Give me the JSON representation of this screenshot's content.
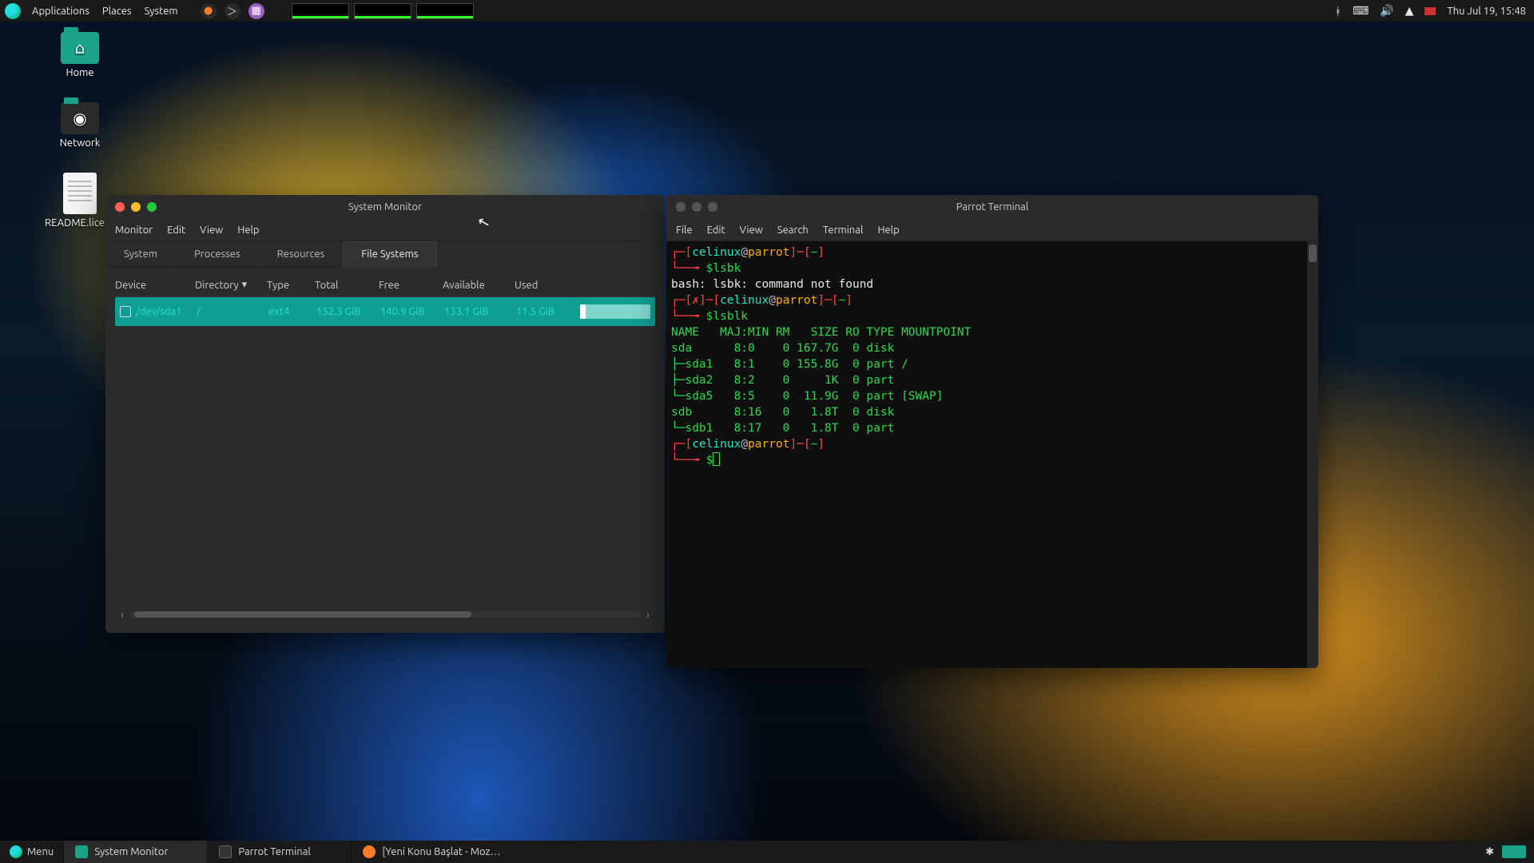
{
  "top_panel": {
    "menus": [
      "Applications",
      "Places",
      "System"
    ],
    "datetime": "Thu Jul 19, 15:48"
  },
  "desktop": {
    "icons": [
      {
        "label": "Home"
      },
      {
        "label": "Network"
      },
      {
        "label": "README.licens"
      }
    ]
  },
  "sysmon": {
    "title": "System Monitor",
    "menus": [
      "Monitor",
      "Edit",
      "View",
      "Help"
    ],
    "tabs": [
      "System",
      "Processes",
      "Resources",
      "File Systems"
    ],
    "active_tab": 3,
    "columns": [
      "Device",
      "Directory",
      "Type",
      "Total",
      "Free",
      "Available",
      "Used"
    ],
    "row": {
      "device": "/dev/sda1",
      "directory": "/",
      "type": "ext4",
      "total": "152.3 GiB",
      "free": "140.9 GiB",
      "available": "133.1 GiB",
      "used": "11.5 GiB",
      "used_pct": 8
    }
  },
  "terminal": {
    "title": "Parrot Terminal",
    "menus": [
      "File",
      "Edit",
      "View",
      "Search",
      "Terminal",
      "Help"
    ],
    "user": "celinux",
    "host": "parrot",
    "cwd": "~",
    "cmd1": "$lsbk",
    "err": "bash: lsbk: command not found",
    "cmd2": "$lsblk",
    "hdr": "NAME   MAJ:MIN RM   SIZE RO TYPE MOUNTPOINT",
    "rows": [
      "sda      8:0    0 167.7G  0 disk",
      "├─sda1   8:1    0 155.8G  0 part /",
      "├─sda2   8:2    0     1K  0 part",
      "└─sda5   8:5    0  11.9G  0 part [SWAP]",
      "sdb      8:16   0   1.8T  0 disk",
      "└─sdb1   8:17   0   1.8T  0 part"
    ],
    "prompt_dollar": "$"
  },
  "taskbar": {
    "menu": "Menu",
    "items": [
      {
        "label": "System Monitor",
        "active": true
      },
      {
        "label": "Parrot Terminal",
        "active": false
      },
      {
        "label": "[Yeni Konu Başlat - Moz…",
        "active": false
      }
    ]
  }
}
